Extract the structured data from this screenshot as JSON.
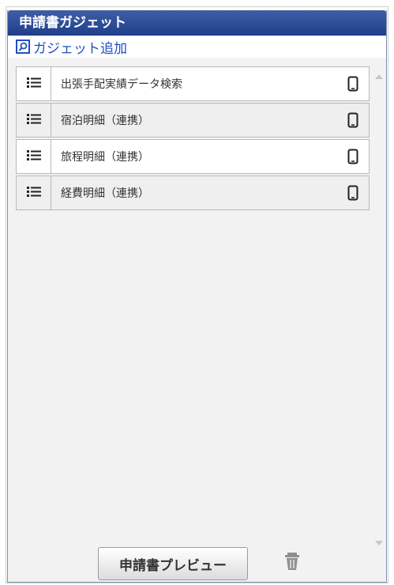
{
  "panel": {
    "title": "申請書ガジェット",
    "add_gadget_label": "ガジェット追加"
  },
  "items": [
    {
      "label": "出張手配実績データ検索",
      "handle_icon": "list-icon",
      "device_icon": "smartphone-icon"
    },
    {
      "label": "宿泊明細（連携）",
      "handle_icon": "list-icon",
      "device_icon": "smartphone-icon"
    },
    {
      "label": "旅程明細（連携）",
      "handle_icon": "list-icon",
      "device_icon": "smartphone-icon"
    },
    {
      "label": "経費明細（連携）",
      "handle_icon": "list-icon",
      "device_icon": "smartphone-icon"
    }
  ],
  "footer": {
    "preview_label": "申請書プレビュー",
    "trash_icon": "trash-icon"
  },
  "colors": {
    "header": "#1f3f8a",
    "link": "#1f4fbf",
    "panel_bg": "#f2f2f2"
  }
}
